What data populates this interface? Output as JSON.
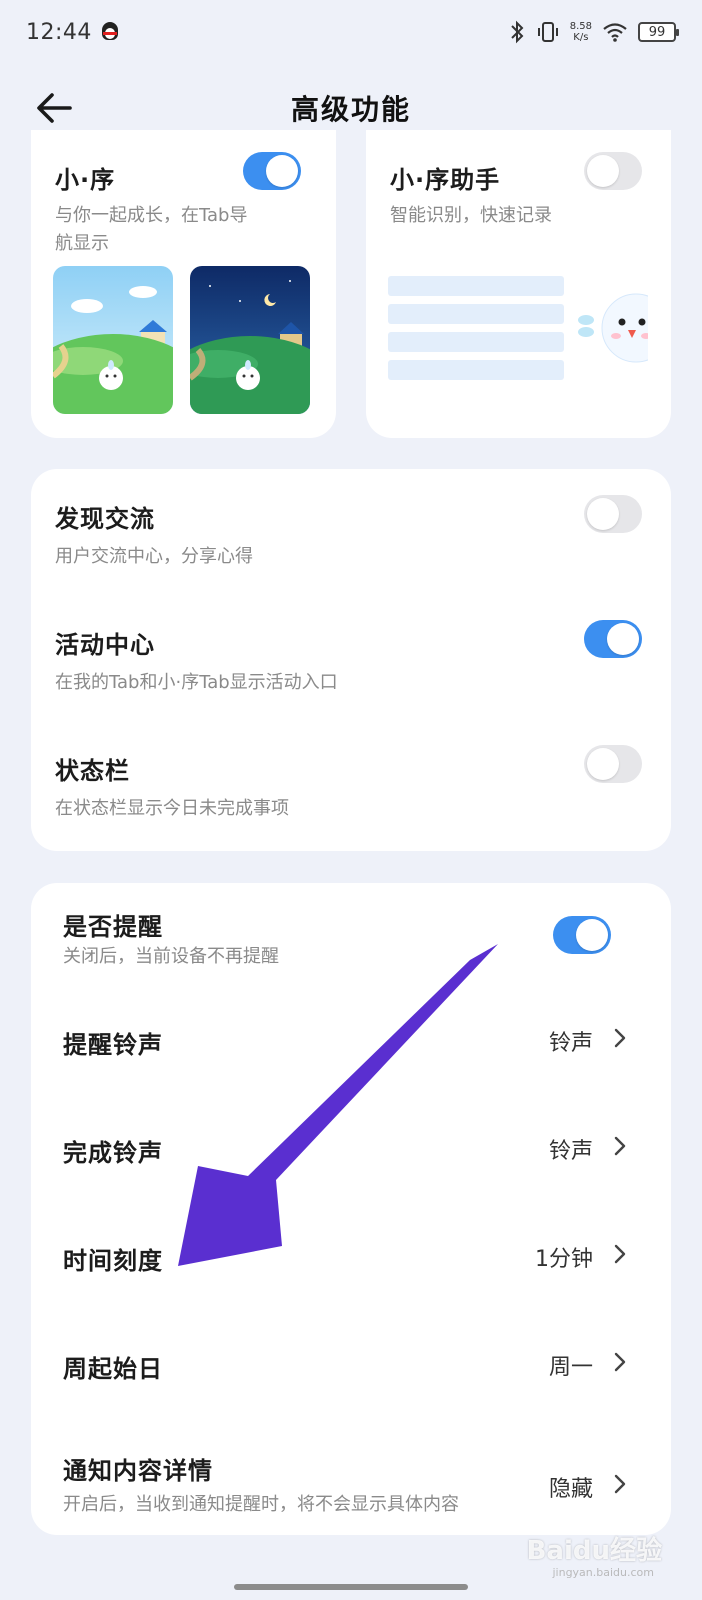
{
  "status_bar": {
    "time": "12:44",
    "net_speed_value": "8.58",
    "net_speed_unit": "K/s",
    "battery": "99"
  },
  "header": {
    "title": "高级功能"
  },
  "feature_cards": [
    {
      "title": "小·序",
      "description_line1": "与你一起成长，在Tab导",
      "description_line2": "航显示",
      "enabled": true
    },
    {
      "title": "小·序助手",
      "description": "智能识别，快速记录",
      "enabled": false
    }
  ],
  "general_settings": [
    {
      "title": "发现交流",
      "description": "用户交流中心，分享心得",
      "enabled": false
    },
    {
      "title": "活动中心",
      "description": "在我的Tab和小·序Tab显示活动入口",
      "enabled": true
    },
    {
      "title": "状态栏",
      "description": "在状态栏显示今日未完成事项",
      "enabled": false
    }
  ],
  "reminder_settings": {
    "reminder_toggle": {
      "title": "是否提醒",
      "description": "关闭后，当前设备不再提醒",
      "enabled": true
    },
    "rows": [
      {
        "title": "提醒铃声",
        "value": "铃声"
      },
      {
        "title": "完成铃声",
        "value": "铃声"
      },
      {
        "title": "时间刻度",
        "value": "1分钟"
      },
      {
        "title": "周起始日",
        "value": "周一"
      },
      {
        "title": "通知内容详情",
        "description": "开启后，当收到通知提醒时，将不会显示具体内容",
        "value": "隐藏"
      }
    ]
  },
  "watermark": {
    "text": "Baidu经验",
    "sub": "jingyan.baidu.com"
  },
  "colors": {
    "accent": "#3c8ff0",
    "annotation_arrow": "#5a2fd0",
    "background": "#eef1f9"
  }
}
